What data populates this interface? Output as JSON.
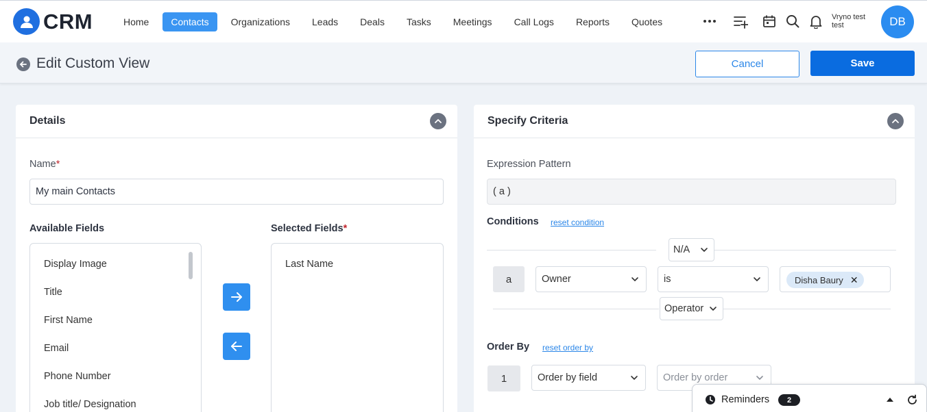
{
  "app": {
    "logo_text": "CRM"
  },
  "nav": {
    "items": [
      {
        "label": "Home",
        "active": false
      },
      {
        "label": "Contacts",
        "active": true
      },
      {
        "label": "Organizations",
        "active": false
      },
      {
        "label": "Leads",
        "active": false
      },
      {
        "label": "Deals",
        "active": false
      },
      {
        "label": "Tasks",
        "active": false
      },
      {
        "label": "Meetings",
        "active": false
      },
      {
        "label": "Call Logs",
        "active": false
      },
      {
        "label": "Reports",
        "active": false
      },
      {
        "label": "Quotes",
        "active": false
      }
    ]
  },
  "header": {
    "user_line1": "Vryno test",
    "user_line2": "test",
    "avatar_initials": "DB",
    "icons": [
      "more-icon",
      "add-list-icon",
      "calendar-icon",
      "search-icon",
      "bell-icon"
    ]
  },
  "subheader": {
    "title": "Edit Custom View",
    "cancel_label": "Cancel",
    "save_label": "Save"
  },
  "details": {
    "title": "Details",
    "name_label": "Name",
    "name_required": "*",
    "name_value": "My main Contacts",
    "available_label": "Available Fields",
    "available_fields": [
      "Display Image",
      "Title",
      "First Name",
      "Email",
      "Phone Number",
      "Job title/ Designation"
    ],
    "selected_label": "Selected Fields",
    "selected_required": "*",
    "selected_fields": [
      "Last Name"
    ]
  },
  "criteria": {
    "title": "Specify Criteria",
    "expression_label": "Expression Pattern",
    "expression_value": "( a )",
    "conditions_label": "Conditions",
    "reset_condition": "reset condition",
    "top_operator": "N/A",
    "condition": {
      "letter": "a",
      "field": "Owner",
      "operator": "is",
      "value_chip": "Disha Baury"
    },
    "bottom_operator": "Operator",
    "order_by_label": "Order By",
    "reset_order_by": "reset order by",
    "order_row": {
      "index": "1",
      "field_placeholder": "Order by field",
      "order_placeholder": "Order by order"
    }
  },
  "reminders": {
    "label": "Reminders",
    "count": "2"
  },
  "colors": {
    "primary": "#0a6ce0",
    "nav_active": "#3a95f2",
    "required": "#c0262d"
  }
}
